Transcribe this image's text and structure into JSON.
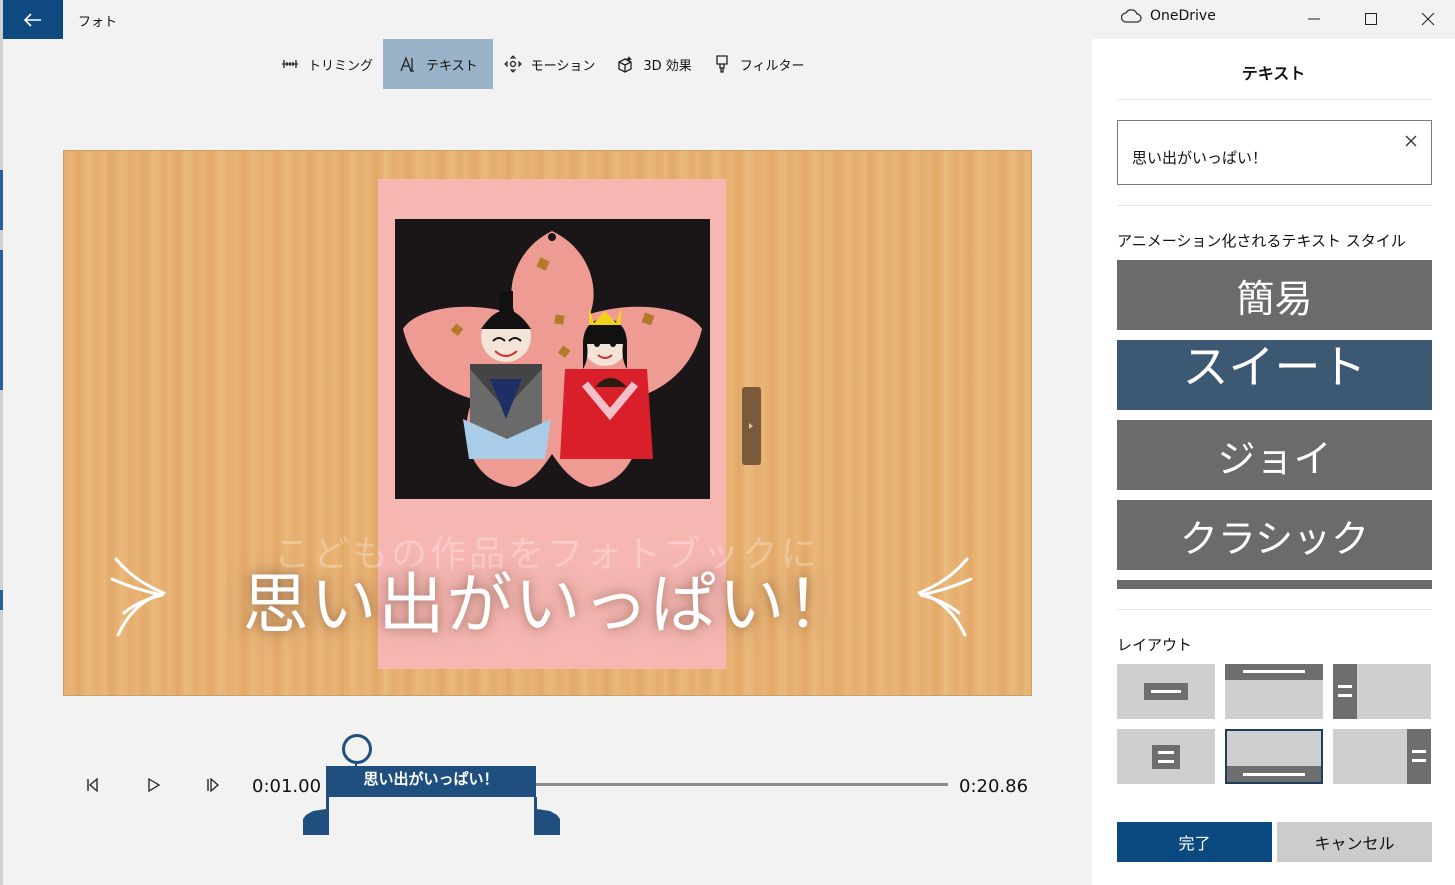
{
  "app": {
    "title": "フォト"
  },
  "toolbar": {
    "items": [
      {
        "label": "トリミング",
        "icon": "trim-icon"
      },
      {
        "label": "テキスト",
        "icon": "text-icon",
        "active": true
      },
      {
        "label": "モーション",
        "icon": "motion-icon"
      },
      {
        "label": "3D 効果",
        "icon": "3d-effects-icon"
      },
      {
        "label": "フィルター",
        "icon": "filter-icon"
      }
    ]
  },
  "preview": {
    "overlay_text": "思い出がいっぱい！",
    "background_text": "こどもの作品をフォトブックに"
  },
  "timeline": {
    "start_time": "0:01.00",
    "end_time": "0:20.86",
    "segment_label": "思い出がいっぱい！"
  },
  "account": {
    "name": "OneDrive"
  },
  "panel": {
    "title": "テキスト",
    "text_value": "思い出がいっぱい！",
    "styles_label": "アニメーション化されるテキスト スタイル",
    "styles": [
      "簡易",
      "スイート",
      "ジョイ",
      "クラシック"
    ],
    "selected_style": "スイート",
    "layout_label": "レイアウト",
    "done_label": "完了",
    "cancel_label": "キャンセル"
  },
  "colors": {
    "accent": "#0b4a80",
    "selected_style": "#3c5873",
    "style_tile": "#6b6b6b",
    "toolbar_active": "#9bb3c9"
  }
}
